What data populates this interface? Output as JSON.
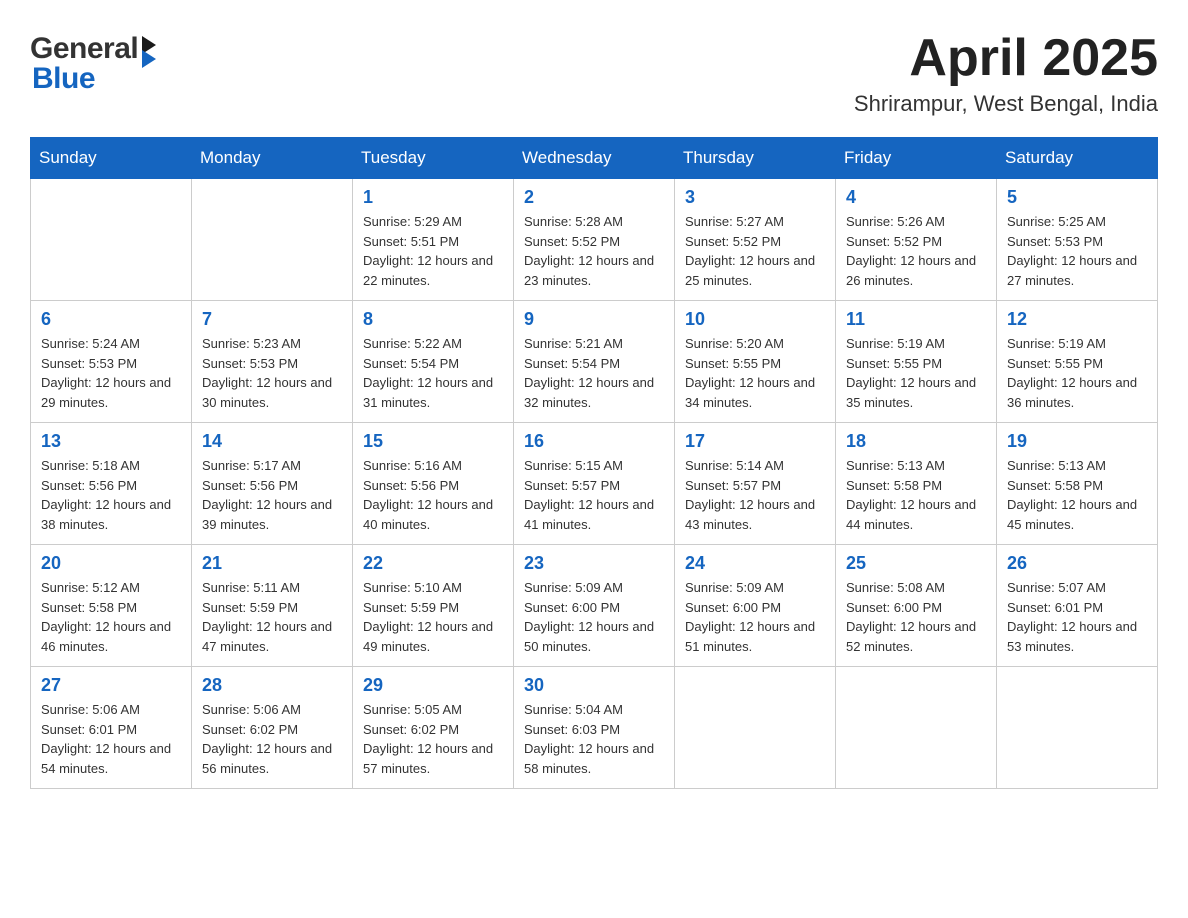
{
  "header": {
    "logo_general": "General",
    "logo_blue": "Blue",
    "month_year": "April 2025",
    "location": "Shrirampur, West Bengal, India"
  },
  "days_of_week": [
    "Sunday",
    "Monday",
    "Tuesday",
    "Wednesday",
    "Thursday",
    "Friday",
    "Saturday"
  ],
  "weeks": [
    [
      {
        "day": "",
        "sunrise": "",
        "sunset": "",
        "daylight": ""
      },
      {
        "day": "",
        "sunrise": "",
        "sunset": "",
        "daylight": ""
      },
      {
        "day": "1",
        "sunrise": "Sunrise: 5:29 AM",
        "sunset": "Sunset: 5:51 PM",
        "daylight": "Daylight: 12 hours and 22 minutes."
      },
      {
        "day": "2",
        "sunrise": "Sunrise: 5:28 AM",
        "sunset": "Sunset: 5:52 PM",
        "daylight": "Daylight: 12 hours and 23 minutes."
      },
      {
        "day": "3",
        "sunrise": "Sunrise: 5:27 AM",
        "sunset": "Sunset: 5:52 PM",
        "daylight": "Daylight: 12 hours and 25 minutes."
      },
      {
        "day": "4",
        "sunrise": "Sunrise: 5:26 AM",
        "sunset": "Sunset: 5:52 PM",
        "daylight": "Daylight: 12 hours and 26 minutes."
      },
      {
        "day": "5",
        "sunrise": "Sunrise: 5:25 AM",
        "sunset": "Sunset: 5:53 PM",
        "daylight": "Daylight: 12 hours and 27 minutes."
      }
    ],
    [
      {
        "day": "6",
        "sunrise": "Sunrise: 5:24 AM",
        "sunset": "Sunset: 5:53 PM",
        "daylight": "Daylight: 12 hours and 29 minutes."
      },
      {
        "day": "7",
        "sunrise": "Sunrise: 5:23 AM",
        "sunset": "Sunset: 5:53 PM",
        "daylight": "Daylight: 12 hours and 30 minutes."
      },
      {
        "day": "8",
        "sunrise": "Sunrise: 5:22 AM",
        "sunset": "Sunset: 5:54 PM",
        "daylight": "Daylight: 12 hours and 31 minutes."
      },
      {
        "day": "9",
        "sunrise": "Sunrise: 5:21 AM",
        "sunset": "Sunset: 5:54 PM",
        "daylight": "Daylight: 12 hours and 32 minutes."
      },
      {
        "day": "10",
        "sunrise": "Sunrise: 5:20 AM",
        "sunset": "Sunset: 5:55 PM",
        "daylight": "Daylight: 12 hours and 34 minutes."
      },
      {
        "day": "11",
        "sunrise": "Sunrise: 5:19 AM",
        "sunset": "Sunset: 5:55 PM",
        "daylight": "Daylight: 12 hours and 35 minutes."
      },
      {
        "day": "12",
        "sunrise": "Sunrise: 5:19 AM",
        "sunset": "Sunset: 5:55 PM",
        "daylight": "Daylight: 12 hours and 36 minutes."
      }
    ],
    [
      {
        "day": "13",
        "sunrise": "Sunrise: 5:18 AM",
        "sunset": "Sunset: 5:56 PM",
        "daylight": "Daylight: 12 hours and 38 minutes."
      },
      {
        "day": "14",
        "sunrise": "Sunrise: 5:17 AM",
        "sunset": "Sunset: 5:56 PM",
        "daylight": "Daylight: 12 hours and 39 minutes."
      },
      {
        "day": "15",
        "sunrise": "Sunrise: 5:16 AM",
        "sunset": "Sunset: 5:56 PM",
        "daylight": "Daylight: 12 hours and 40 minutes."
      },
      {
        "day": "16",
        "sunrise": "Sunrise: 5:15 AM",
        "sunset": "Sunset: 5:57 PM",
        "daylight": "Daylight: 12 hours and 41 minutes."
      },
      {
        "day": "17",
        "sunrise": "Sunrise: 5:14 AM",
        "sunset": "Sunset: 5:57 PM",
        "daylight": "Daylight: 12 hours and 43 minutes."
      },
      {
        "day": "18",
        "sunrise": "Sunrise: 5:13 AM",
        "sunset": "Sunset: 5:58 PM",
        "daylight": "Daylight: 12 hours and 44 minutes."
      },
      {
        "day": "19",
        "sunrise": "Sunrise: 5:13 AM",
        "sunset": "Sunset: 5:58 PM",
        "daylight": "Daylight: 12 hours and 45 minutes."
      }
    ],
    [
      {
        "day": "20",
        "sunrise": "Sunrise: 5:12 AM",
        "sunset": "Sunset: 5:58 PM",
        "daylight": "Daylight: 12 hours and 46 minutes."
      },
      {
        "day": "21",
        "sunrise": "Sunrise: 5:11 AM",
        "sunset": "Sunset: 5:59 PM",
        "daylight": "Daylight: 12 hours and 47 minutes."
      },
      {
        "day": "22",
        "sunrise": "Sunrise: 5:10 AM",
        "sunset": "Sunset: 5:59 PM",
        "daylight": "Daylight: 12 hours and 49 minutes."
      },
      {
        "day": "23",
        "sunrise": "Sunrise: 5:09 AM",
        "sunset": "Sunset: 6:00 PM",
        "daylight": "Daylight: 12 hours and 50 minutes."
      },
      {
        "day": "24",
        "sunrise": "Sunrise: 5:09 AM",
        "sunset": "Sunset: 6:00 PM",
        "daylight": "Daylight: 12 hours and 51 minutes."
      },
      {
        "day": "25",
        "sunrise": "Sunrise: 5:08 AM",
        "sunset": "Sunset: 6:00 PM",
        "daylight": "Daylight: 12 hours and 52 minutes."
      },
      {
        "day": "26",
        "sunrise": "Sunrise: 5:07 AM",
        "sunset": "Sunset: 6:01 PM",
        "daylight": "Daylight: 12 hours and 53 minutes."
      }
    ],
    [
      {
        "day": "27",
        "sunrise": "Sunrise: 5:06 AM",
        "sunset": "Sunset: 6:01 PM",
        "daylight": "Daylight: 12 hours and 54 minutes."
      },
      {
        "day": "28",
        "sunrise": "Sunrise: 5:06 AM",
        "sunset": "Sunset: 6:02 PM",
        "daylight": "Daylight: 12 hours and 56 minutes."
      },
      {
        "day": "29",
        "sunrise": "Sunrise: 5:05 AM",
        "sunset": "Sunset: 6:02 PM",
        "daylight": "Daylight: 12 hours and 57 minutes."
      },
      {
        "day": "30",
        "sunrise": "Sunrise: 5:04 AM",
        "sunset": "Sunset: 6:03 PM",
        "daylight": "Daylight: 12 hours and 58 minutes."
      },
      {
        "day": "",
        "sunrise": "",
        "sunset": "",
        "daylight": ""
      },
      {
        "day": "",
        "sunrise": "",
        "sunset": "",
        "daylight": ""
      },
      {
        "day": "",
        "sunrise": "",
        "sunset": "",
        "daylight": ""
      }
    ]
  ]
}
